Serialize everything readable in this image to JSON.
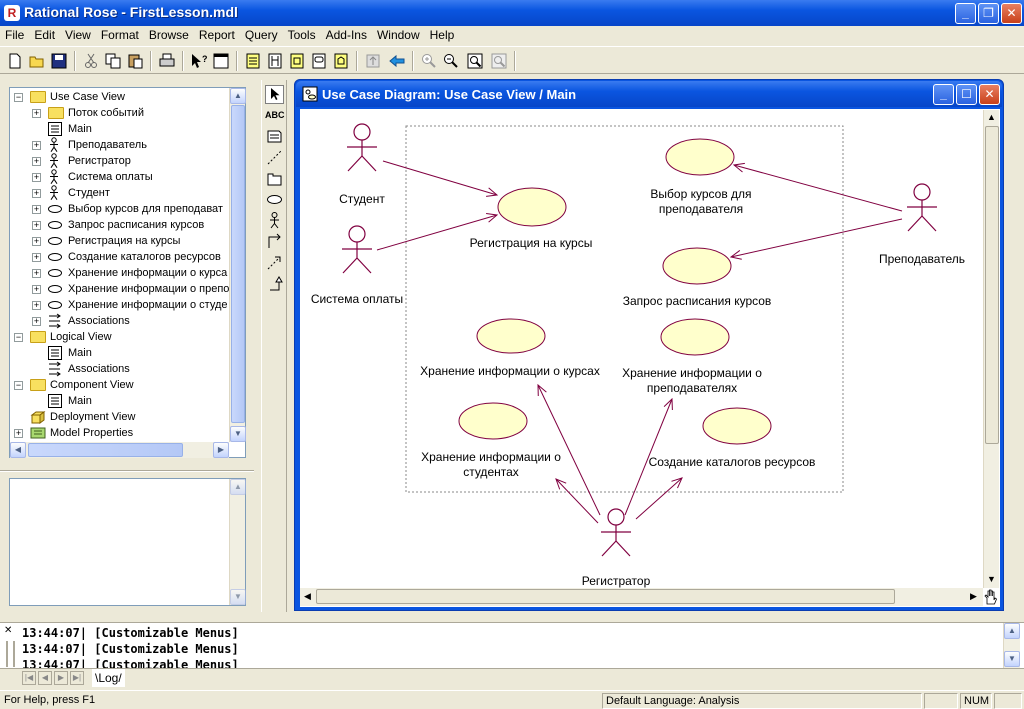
{
  "window": {
    "title": "Rational Rose - FirstLesson.mdl",
    "app_icon_glyph": "R",
    "minimize": "_",
    "maximize": "❐",
    "close": "✕"
  },
  "menu": [
    "File",
    "Edit",
    "View",
    "Format",
    "Browse",
    "Report",
    "Query",
    "Tools",
    "Add-Ins",
    "Window",
    "Help"
  ],
  "browser_tree": [
    {
      "level": 0,
      "icon": "folder",
      "label": "Use Case View",
      "expander": "−"
    },
    {
      "level": 1,
      "icon": "folder",
      "label": "Поток событий",
      "expander": "+"
    },
    {
      "level": 1,
      "icon": "diagram",
      "label": "Main",
      "expander": ""
    },
    {
      "level": 1,
      "icon": "actor",
      "label": "Преподаватель",
      "expander": "+"
    },
    {
      "level": 1,
      "icon": "actor",
      "label": "Регистратор",
      "expander": "+"
    },
    {
      "level": 1,
      "icon": "actor",
      "label": "Система оплаты",
      "expander": "+"
    },
    {
      "level": 1,
      "icon": "actor",
      "label": "Студент",
      "expander": "+"
    },
    {
      "level": 1,
      "icon": "usecase",
      "label": "Выбор курсов для преподават",
      "expander": "+"
    },
    {
      "level": 1,
      "icon": "usecase",
      "label": "Запрос расписания курсов",
      "expander": "+"
    },
    {
      "level": 1,
      "icon": "usecase",
      "label": "Регистрация на курсы",
      "expander": "+"
    },
    {
      "level": 1,
      "icon": "usecase",
      "label": "Создание каталогов ресурсов",
      "expander": "+"
    },
    {
      "level": 1,
      "icon": "usecase",
      "label": "Хранение информации о курса",
      "expander": "+"
    },
    {
      "level": 1,
      "icon": "usecase",
      "label": "Хранение информации о препо",
      "expander": "+"
    },
    {
      "level": 1,
      "icon": "usecase",
      "label": "Хранение информации о студе",
      "expander": "+"
    },
    {
      "level": 1,
      "icon": "assoc",
      "label": "Associations",
      "expander": "+"
    },
    {
      "level": 0,
      "icon": "folder",
      "label": "Logical View",
      "expander": "−"
    },
    {
      "level": 1,
      "icon": "diagram",
      "label": "Main",
      "expander": ""
    },
    {
      "level": 1,
      "icon": "assoc",
      "label": "Associations",
      "expander": ""
    },
    {
      "level": 0,
      "icon": "folder",
      "label": "Component View",
      "expander": "−"
    },
    {
      "level": 1,
      "icon": "diagram",
      "label": "Main",
      "expander": ""
    },
    {
      "level": 0,
      "icon": "deploy",
      "label": "Deployment View",
      "expander": ""
    },
    {
      "level": 0,
      "icon": "props",
      "label": "Model Properties",
      "expander": "+"
    }
  ],
  "toolbox_text_tool": "ABC",
  "diagram": {
    "title": "Use Case Diagram: Use Case View / Main",
    "actors": [
      {
        "id": "student",
        "label": "Студент"
      },
      {
        "id": "payment",
        "label": "Система оплаты"
      },
      {
        "id": "teacher",
        "label": "Преподаватель"
      },
      {
        "id": "registrar",
        "label": "Регистратор"
      }
    ],
    "use_cases": [
      {
        "id": "reg",
        "label": "Регистрация на курсы"
      },
      {
        "id": "choose",
        "label": "Выбор курсов для преподавателя"
      },
      {
        "id": "schedule",
        "label": "Запрос расписания курсов"
      },
      {
        "id": "store_courses",
        "label": "Хранение информации о курсах"
      },
      {
        "id": "store_teachers",
        "label": "Хранение информации о преподавателях"
      },
      {
        "id": "store_students",
        "label": "Хранение информации о студентах"
      },
      {
        "id": "catalogs",
        "label": "Создание каталогов ресурсов"
      }
    ],
    "label_lines": {
      "choose": [
        "Выбор курсов для",
        "преподавателя"
      ],
      "store_teachers": [
        "Хранение информации о",
        "преподавателях"
      ],
      "store_students": [
        "Хранение информации о",
        "студентах"
      ]
    },
    "associations": [
      [
        "student",
        "reg"
      ],
      [
        "payment",
        "reg"
      ],
      [
        "teacher",
        "choose"
      ],
      [
        "teacher",
        "schedule"
      ],
      [
        "registrar",
        "store_courses"
      ],
      [
        "registrar",
        "store_teachers"
      ],
      [
        "registrar",
        "store_students"
      ],
      [
        "registrar",
        "catalogs"
      ]
    ],
    "colors": {
      "usecase_fill": "#ffffcc",
      "line": "#800040",
      "actor": "#800040"
    }
  },
  "log": {
    "lines": [
      {
        "time": "13:44:07|",
        "text": "[Customizable Menus]"
      },
      {
        "time": "13:44:07|",
        "text": "[Customizable Menus]"
      },
      {
        "time": "13:44:07|",
        "text": "[Customizable Menus]"
      }
    ],
    "tab": "\\Log/"
  },
  "status": {
    "help": "For Help, press F1",
    "language": "Default Language: Analysis",
    "num": "NUM"
  }
}
